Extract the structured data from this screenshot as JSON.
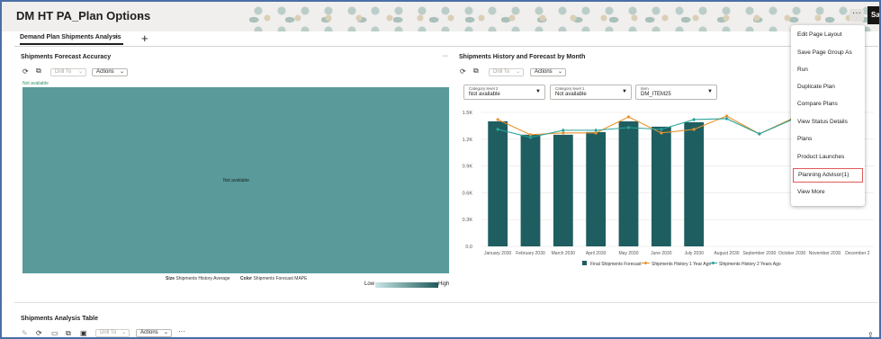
{
  "header": {
    "title": "DM HT PA_Plan Options",
    "title_chevron": "⌄",
    "more_label": "···",
    "save_label": "Sa"
  },
  "tabs": [
    {
      "label": "Demand Plan Shipments Analysis",
      "close": "×"
    }
  ],
  "tab_add": "+",
  "forecast_panel": {
    "title": "Shipments Forecast Accuracy",
    "drill_to": "Drill To",
    "actions": "Actions",
    "not_available_label": "Not available",
    "not_available_center": "Not available",
    "legend_size_label": "Size",
    "legend_size_value": "Shipments History Average",
    "legend_color_label": "Color",
    "legend_color_value": "Shipments Forecast MAPE",
    "gradient_low": "Low",
    "gradient_high": "High",
    "heat_color": "#5a9a9a"
  },
  "history_panel": {
    "title": "Shipments History and Forecast by Month",
    "more_label": "···",
    "drill_to": "Drill To",
    "actions": "Actions",
    "filters": [
      {
        "label": "Category level 2",
        "value": "Not available"
      },
      {
        "label": "Category level 1",
        "value": "Not available"
      },
      {
        "label": "Item",
        "value": "DM_ITEM25"
      }
    ]
  },
  "chart_data": {
    "type": "bar",
    "categories": [
      "January 2030",
      "February 2030",
      "March 2030",
      "April 2030",
      "May 2030",
      "June 2030",
      "July 2030",
      "August 2030",
      "September 2030",
      "October 2030",
      "November 2030",
      "December 2"
    ],
    "y_ticks": [
      "1.5K",
      "1.2K",
      "0.9K",
      "0.6K",
      "0.3K",
      "0.0"
    ],
    "ylim": [
      0,
      1500
    ],
    "series": [
      {
        "name": "Final Shipments Forecast",
        "type": "bar",
        "color": "#1f5e60",
        "values": [
          1400,
          1250,
          1250,
          1280,
          1400,
          1340,
          1390,
          null,
          null,
          null,
          null,
          null
        ]
      },
      {
        "name": "Shipments History 1 Year Ago",
        "type": "line",
        "color": "#e8922c",
        "values": [
          1420,
          1250,
          1270,
          1270,
          1450,
          1270,
          1310,
          1460,
          1260,
          1430,
          1310,
          1370
        ]
      },
      {
        "name": "Shipments History 2 Years Ago",
        "type": "line",
        "color": "#2aa39a",
        "values": [
          1310,
          1220,
          1300,
          1300,
          1330,
          1310,
          1420,
          1430,
          1260,
          1420,
          1270,
          1320
        ]
      }
    ]
  },
  "menu": {
    "items": [
      "Edit Page Layout",
      "Save Page Group As",
      "Run",
      "Duplicate Plan",
      "Compare Plans",
      "View Status Details",
      "Plans",
      "Product Launches",
      "Planning Advisor(1)",
      "View More"
    ],
    "highlighted_index": 8
  },
  "table_panel": {
    "title": "Shipments Analysis Table",
    "drill_to": "Drill To",
    "actions": "Actions",
    "more_label": "···"
  }
}
